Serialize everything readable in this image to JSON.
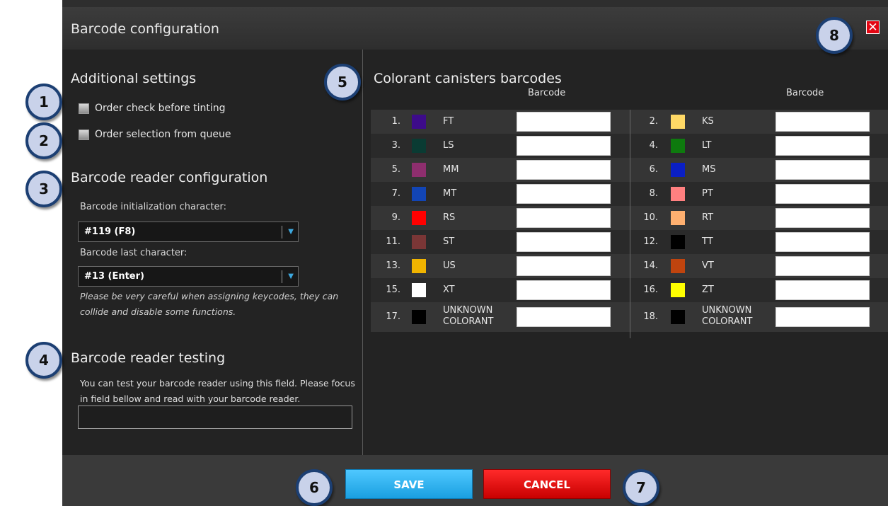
{
  "dialog": {
    "title": "Barcode configuration",
    "close_glyph": "✕"
  },
  "additional": {
    "heading": "Additional settings",
    "order_check": "Order check before tinting",
    "order_selection": "Order selection from queue"
  },
  "reader_config": {
    "heading": "Barcode reader configuration",
    "init_label": "Barcode initialization character:",
    "init_value": "#119 (F8)",
    "last_label": "Barcode last character:",
    "last_value": "#13 (Enter)",
    "note": "Please be very careful when assigning keycodes, they can collide and disable some functions."
  },
  "reader_testing": {
    "heading": "Barcode reader testing",
    "text": "You can test your barcode reader using this field. Please focus in field bellow and read with your barcode reader."
  },
  "colorants": {
    "heading": "Colorant canisters barcodes",
    "column_header": "Barcode",
    "left": [
      {
        "num": "1.",
        "name": "FT",
        "color": "#3d0b8a"
      },
      {
        "num": "3.",
        "name": "LS",
        "color": "#0a3b33"
      },
      {
        "num": "5.",
        "name": "MM",
        "color": "#8e2e6e"
      },
      {
        "num": "7.",
        "name": "MT",
        "color": "#1245b5"
      },
      {
        "num": "9.",
        "name": "RS",
        "color": "#ff0000"
      },
      {
        "num": "11.",
        "name": "ST",
        "color": "#7a3636"
      },
      {
        "num": "13.",
        "name": "US",
        "color": "#f0b400"
      },
      {
        "num": "15.",
        "name": "XT",
        "color": "#ffffff"
      },
      {
        "num": "17.",
        "name": "UNKNOWN COLORANT",
        "color": "#000000"
      }
    ],
    "right": [
      {
        "num": "2.",
        "name": "KS",
        "color": "#ffd966"
      },
      {
        "num": "4.",
        "name": "LT",
        "color": "#0e7a0e"
      },
      {
        "num": "6.",
        "name": "MS",
        "color": "#0a1fc4"
      },
      {
        "num": "8.",
        "name": "PT",
        "color": "#ff8080"
      },
      {
        "num": "10.",
        "name": "RT",
        "color": "#ffb070"
      },
      {
        "num": "12.",
        "name": "TT",
        "color": "#000000"
      },
      {
        "num": "14.",
        "name": "VT",
        "color": "#c0440e"
      },
      {
        "num": "16.",
        "name": "ZT",
        "color": "#ffff00"
      },
      {
        "num": "18.",
        "name": "UNKNOWN COLORANT",
        "color": "#000000"
      }
    ]
  },
  "footer": {
    "save": "SAVE",
    "cancel": "CANCEL"
  },
  "callouts": [
    "1",
    "2",
    "3",
    "4",
    "5",
    "6",
    "7",
    "8"
  ]
}
